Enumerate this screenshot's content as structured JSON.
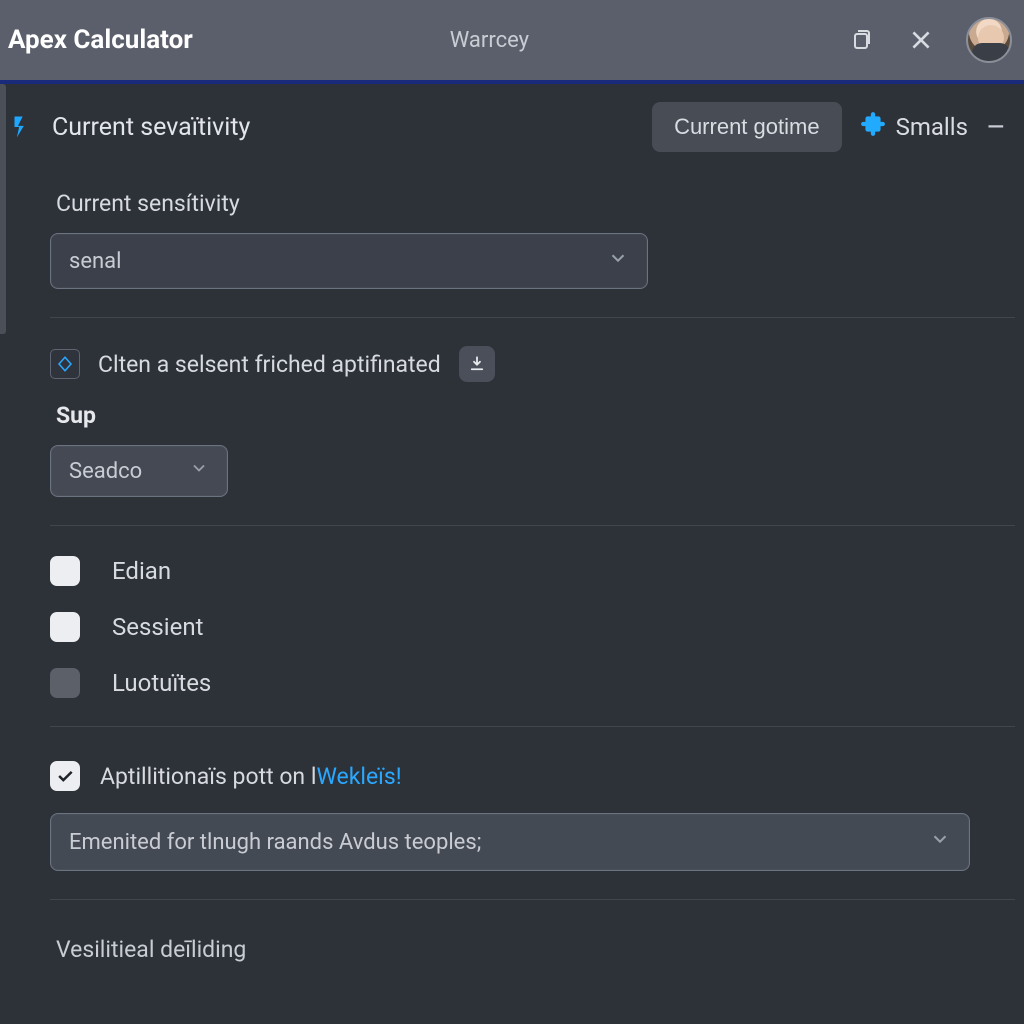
{
  "titlebar": {
    "app_title": "Apex Calculator",
    "center_title": "Warrcey"
  },
  "toolbar": {
    "crumb": "Current sevaïtivity",
    "chip_button": "Current gotime",
    "chip_link": "Smalls"
  },
  "form": {
    "sensitivity_label": "Current sensítivity",
    "sensitivity_value": "senal",
    "inline_note": "Clten a selsent friched aptifinated",
    "sup_label": "Sup",
    "sup_value": "Seadco",
    "checks": [
      {
        "label": "Edian",
        "checked": false,
        "dim": false
      },
      {
        "label": "Sessient",
        "checked": false,
        "dim": false
      },
      {
        "label": "Luotuïtes",
        "checked": false,
        "dim": true
      }
    ],
    "special": {
      "checked": true,
      "text_a": "Aptillitionaïs pott on l",
      "text_b": "Wekleïs!"
    },
    "long_select_value": "Emenited for tlnugh raands Avdus teoples;",
    "bottom_label": "Vesilitieal deīliding"
  }
}
